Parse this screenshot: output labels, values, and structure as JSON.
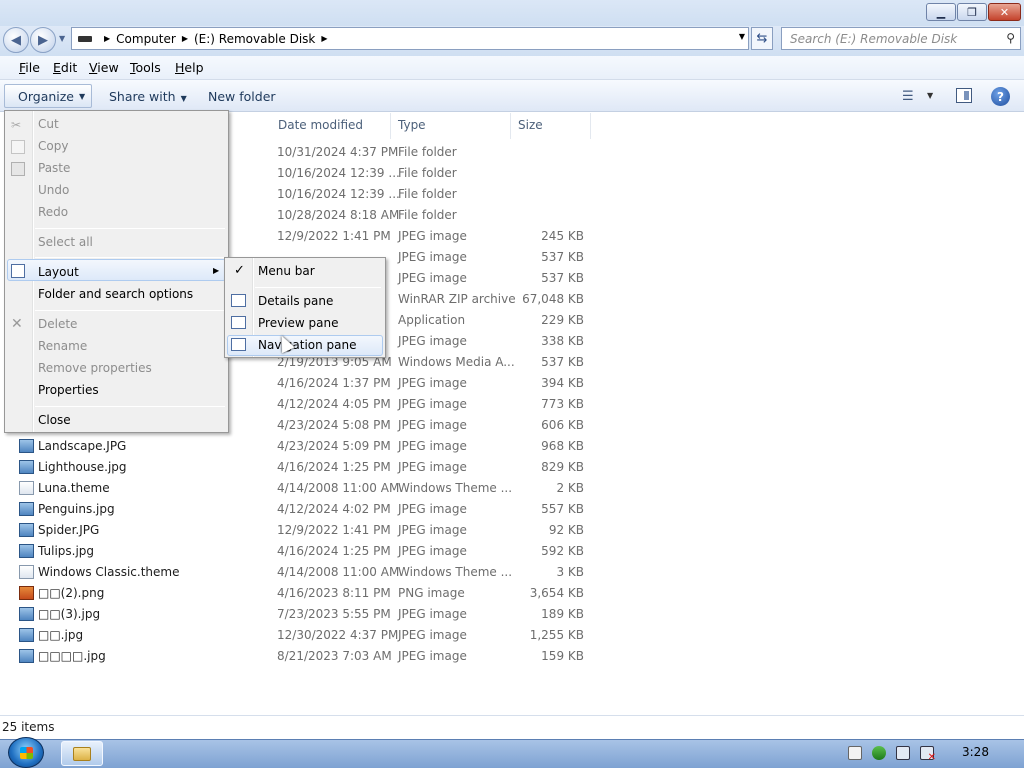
{
  "window": {
    "minimize_symbol": "▁",
    "maximize_symbol": "❐",
    "close_symbol": "✕"
  },
  "address": {
    "crumbs": [
      "Computer",
      "(E:) Removable Disk"
    ],
    "search_placeholder": "Search (E:) Removable Disk"
  },
  "menubar": {
    "items": [
      {
        "label": "File",
        "accel": "F",
        "rest": "ile"
      },
      {
        "label": "Edit",
        "accel": "E",
        "rest": "dit"
      },
      {
        "label": "View",
        "accel": "V",
        "rest": "iew"
      },
      {
        "label": "Tools",
        "accel": "T",
        "rest": "ools"
      },
      {
        "label": "Help",
        "accel": "H",
        "rest": "elp"
      }
    ]
  },
  "toolbar": {
    "organize_label": "Organize",
    "share_label": "Share with",
    "newfolder_label": "New folder"
  },
  "columns": {
    "date": "Date modified",
    "type": "Type",
    "size": "Size"
  },
  "files": [
    {
      "name": "",
      "date": "10/31/2024 4:37 PM",
      "type": "File folder",
      "size": "",
      "icon": "folder"
    },
    {
      "name": "",
      "date": "10/16/2024 12:39 ...",
      "type": "File folder",
      "size": "",
      "icon": "folder"
    },
    {
      "name": "",
      "date": "10/16/2024 12:39 ...",
      "type": "File folder",
      "size": "",
      "icon": "folder"
    },
    {
      "name": "",
      "date": "10/28/2024 8:18 AM",
      "type": "File folder",
      "size": "",
      "icon": "folder"
    },
    {
      "name": "",
      "date": "12/9/2022 1:41 PM",
      "type": "JPEG image",
      "size": "245 KB",
      "icon": "jpeg"
    },
    {
      "name": "",
      "date": "",
      "type": "JPEG image",
      "size": "537 KB",
      "icon": "jpeg"
    },
    {
      "name": "",
      "date": "",
      "type": "JPEG image",
      "size": "537 KB",
      "icon": "jpeg"
    },
    {
      "name": "",
      "date": "",
      "type": "WinRAR ZIP archive",
      "size": "67,048 KB",
      "icon": "zip"
    },
    {
      "name": "",
      "date": "",
      "type": "Application",
      "size": "229 KB",
      "icon": "app"
    },
    {
      "name": "",
      "date": "",
      "type": "JPEG image",
      "size": "338 KB",
      "icon": "jpeg"
    },
    {
      "name": "",
      "date": "2/19/2013 9:05 AM",
      "type": "Windows Media A...",
      "size": "537 KB",
      "icon": "wma"
    },
    {
      "name": "",
      "date": "4/16/2024 1:37 PM",
      "type": "JPEG image",
      "size": "394 KB",
      "icon": "jpeg"
    },
    {
      "name": "",
      "date": "4/12/2024 4:05 PM",
      "type": "JPEG image",
      "size": "773 KB",
      "icon": "jpeg"
    },
    {
      "name": "",
      "date": "4/23/2024 5:08 PM",
      "type": "JPEG image",
      "size": "606 KB",
      "icon": "jpeg"
    },
    {
      "name": "Landscape.JPG",
      "date": "4/23/2024 5:09 PM",
      "type": "JPEG image",
      "size": "968 KB",
      "icon": "jpeg"
    },
    {
      "name": "Lighthouse.jpg",
      "date": "4/16/2024 1:25 PM",
      "type": "JPEG image",
      "size": "829 KB",
      "icon": "jpeg"
    },
    {
      "name": "Luna.theme",
      "date": "4/14/2008 11:00 AM",
      "type": "Windows Theme ...",
      "size": "2 KB",
      "icon": "theme"
    },
    {
      "name": "Penguins.jpg",
      "date": "4/12/2024 4:02 PM",
      "type": "JPEG image",
      "size": "557 KB",
      "icon": "jpeg"
    },
    {
      "name": "Spider.JPG",
      "date": "12/9/2022 1:41 PM",
      "type": "JPEG image",
      "size": "92 KB",
      "icon": "jpeg"
    },
    {
      "name": "Tulips.jpg",
      "date": "4/16/2024 1:25 PM",
      "type": "JPEG image",
      "size": "592 KB",
      "icon": "jpeg"
    },
    {
      "name": "Windows Classic.theme",
      "date": "4/14/2008 11:00 AM",
      "type": "Windows Theme ...",
      "size": "3 KB",
      "icon": "theme"
    },
    {
      "name": "□□(2).png",
      "date": "4/16/2023 8:11 PM",
      "type": "PNG image",
      "size": "3,654 KB",
      "icon": "png"
    },
    {
      "name": "□□(3).jpg",
      "date": "7/23/2023 5:55 PM",
      "type": "JPEG image",
      "size": "189 KB",
      "icon": "jpeg"
    },
    {
      "name": "□□.jpg",
      "date": "12/30/2022 4:37 PM",
      "type": "JPEG image",
      "size": "1,255 KB",
      "icon": "jpeg"
    },
    {
      "name": "□□□□.jpg",
      "date": "8/21/2023 7:03 AM",
      "type": "JPEG image",
      "size": "159 KB",
      "icon": "jpeg"
    }
  ],
  "status": {
    "items_text": "25 items"
  },
  "organize_menu": {
    "cut": "Cut",
    "copy": "Copy",
    "paste": "Paste",
    "undo": "Undo",
    "redo": "Redo",
    "select_all": "Select all",
    "layout": "Layout",
    "folder_options": "Folder and search options",
    "delete": "Delete",
    "rename": "Rename",
    "remove_properties": "Remove properties",
    "properties": "Properties",
    "close": "Close"
  },
  "layout_submenu": {
    "menu_bar": "Menu bar",
    "menu_bar_checked": true,
    "details_pane": "Details pane",
    "preview_pane": "Preview pane",
    "navigation_pane": "Navigation pane"
  },
  "taskbar": {
    "clock": "3:28"
  }
}
